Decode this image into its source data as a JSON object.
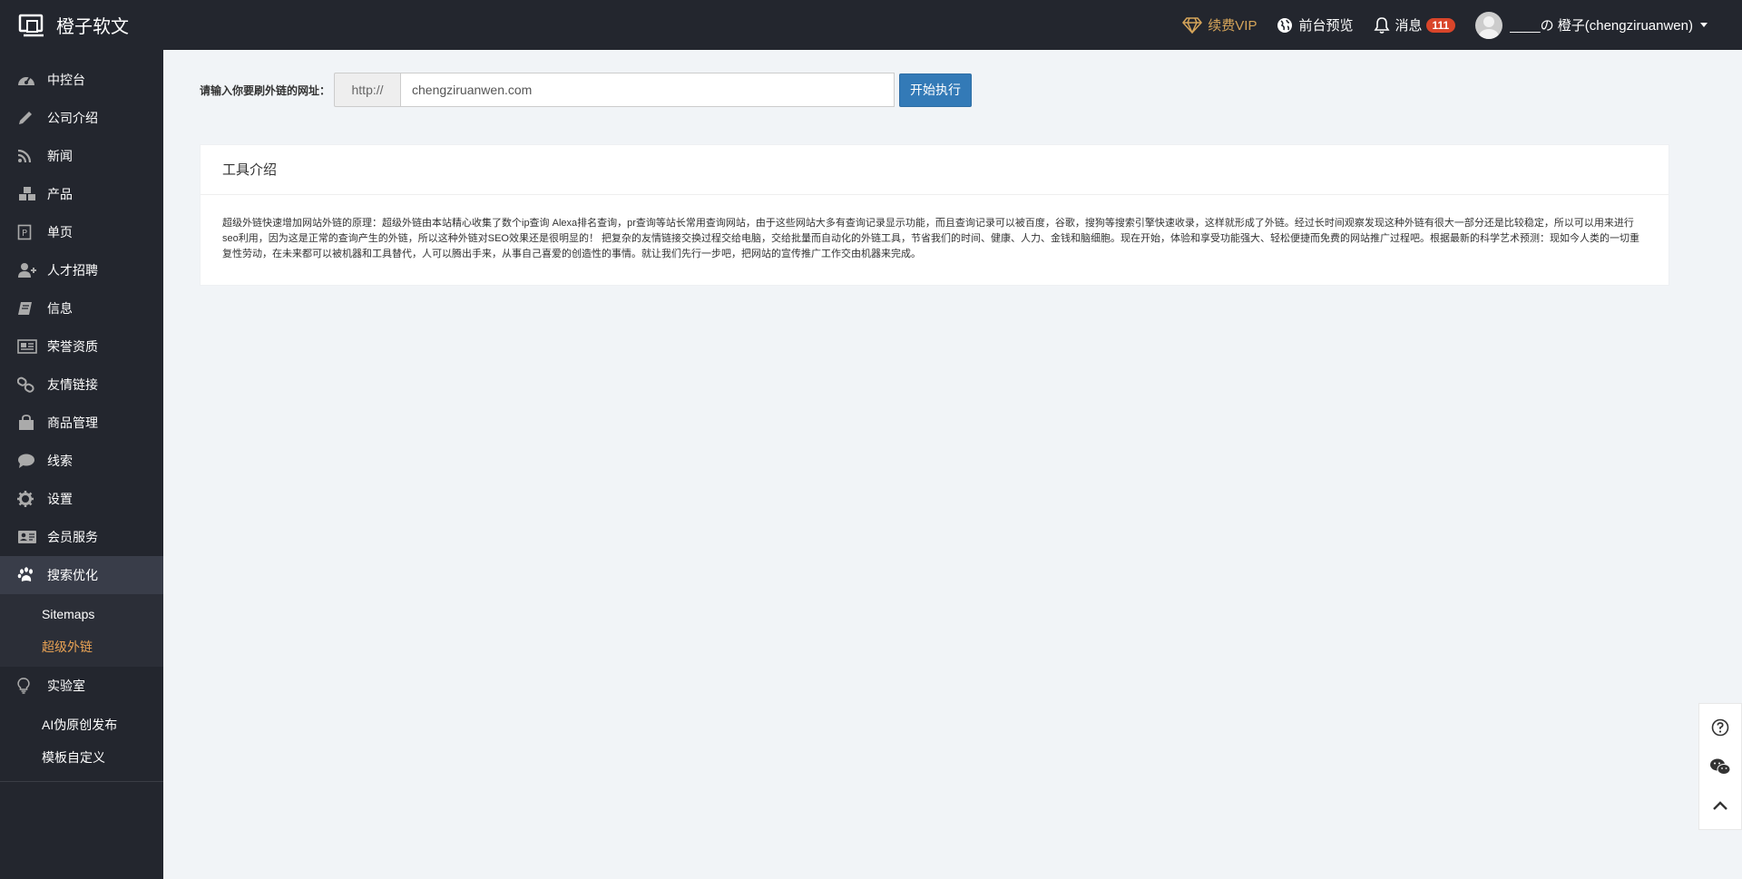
{
  "brand": {
    "name": "橙子软文"
  },
  "header": {
    "vip_label": "续费VIP",
    "preview_label": "前台预览",
    "messages_label": "消息",
    "messages_count": "111",
    "user_name": "____の 橙子(chengziruanwen)"
  },
  "sidebar": {
    "items": [
      {
        "label": "中控台",
        "icon": "dashboard-icon"
      },
      {
        "label": "公司介绍",
        "icon": "pencil-icon"
      },
      {
        "label": "新闻",
        "icon": "rss-icon"
      },
      {
        "label": "产品",
        "icon": "cubes-icon"
      },
      {
        "label": "单页",
        "icon": "page-icon"
      },
      {
        "label": "人才招聘",
        "icon": "user-plus-icon"
      },
      {
        "label": "信息",
        "icon": "book-icon"
      },
      {
        "label": "荣誉资质",
        "icon": "newspaper-icon"
      },
      {
        "label": "友情链接",
        "icon": "link-icon"
      },
      {
        "label": "商品管理",
        "icon": "bag-icon"
      },
      {
        "label": "线索",
        "icon": "chat-icon"
      },
      {
        "label": "设置",
        "icon": "gear-icon"
      },
      {
        "label": "会员服务",
        "icon": "id-card-icon"
      },
      {
        "label": "搜索优化",
        "icon": "paw-icon"
      }
    ],
    "seo_sub": [
      {
        "label": "Sitemaps"
      },
      {
        "label": "超级外链"
      }
    ],
    "lab": {
      "label": "实验室",
      "icon": "lightbulb-icon"
    },
    "lab_sub": [
      {
        "label": "AI伪原创发布"
      },
      {
        "label": "模板自定义"
      }
    ]
  },
  "form": {
    "label": "请输入你要刷外链的网址：",
    "prefix": "http://",
    "value": "chengziruanwen.com",
    "button": "开始执行"
  },
  "panel": {
    "title": "工具介绍",
    "body": "超级外链快速增加网站外链的原理：超级外链由本站精心收集了数个ip查询 Alexa排名查询，pr查询等站长常用查询网站，由于这些网站大多有查询记录显示功能，而且查询记录可以被百度，谷歌，搜狗等搜索引擎快速收录，这样就形成了外链。经过长时间观察发现这种外链有很大一部分还是比较稳定，所以可以用来进行seo利用，因为这是正常的查询产生的外链，所以这种外链对SEO效果还是很明显的！ 把复杂的友情链接交换过程交给电脑，交给批量而自动化的外链工具，节省我们的时间、健康、人力、金钱和脑细胞。现在开始，体验和享受功能强大、轻松便捷而免费的网站推广过程吧。根据最新的科学艺术预测：现如今人类的一切重复性劳动，在未来都可以被机器和工具替代，人可以腾出手来，从事自己喜爱的创造性的事情。就让我们先行一步吧，把网站的宣传推广工作交由机器来完成。"
  },
  "float_bar": [
    "help-icon",
    "wechat-icon",
    "back-to-top-icon"
  ]
}
